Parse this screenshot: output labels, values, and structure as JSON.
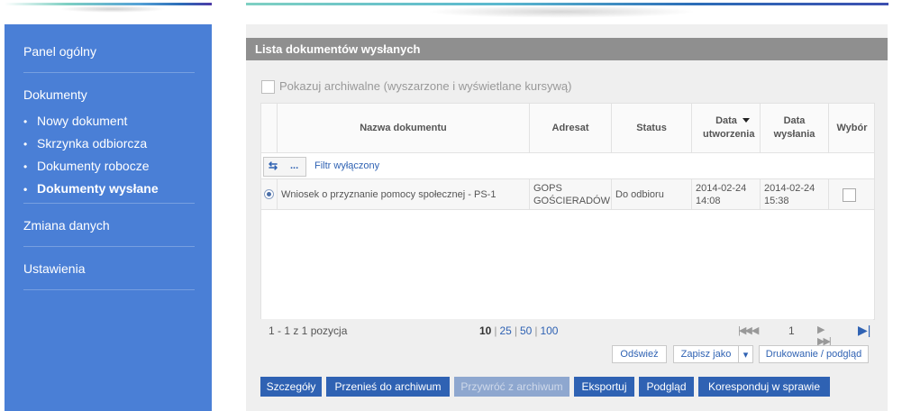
{
  "sidebar": {
    "items": [
      {
        "label": "Panel ogólny"
      },
      {
        "label": "Dokumenty"
      },
      {
        "label": "Zmiana danych"
      },
      {
        "label": "Ustawienia"
      }
    ],
    "sub_items": [
      {
        "label": "Nowy dokument",
        "active": false
      },
      {
        "label": "Skrzynka odbiorcza",
        "active": false
      },
      {
        "label": "Dokumenty robocze",
        "active": false
      },
      {
        "label": "Dokumenty wysłane",
        "active": true
      }
    ],
    "bullet": "•"
  },
  "panel": {
    "title": "Lista dokumentów wysłanych",
    "archive_label": "Pokazuj archiwalne (wyszarzone i wyświetlane kursywą)"
  },
  "grid": {
    "columns": [
      {
        "label": "Nazwa dokumentu"
      },
      {
        "label": "Adresat"
      },
      {
        "label": "Status"
      },
      {
        "label": "Data utworzenia",
        "sorted": "desc"
      },
      {
        "label": "Data wysłania"
      },
      {
        "label": "Wybór"
      }
    ],
    "filter": {
      "icon": "⇆",
      "dots": "...",
      "label": "Filtr wyłączony"
    },
    "rows": [
      {
        "name": "Wniosek o przyznanie pomocy społecznej - PS-1",
        "recipient_line1": "GOPS",
        "recipient_line2": "GOŚCIERADÓW",
        "status": "Do odbioru",
        "created_date": "2014-02-24",
        "created_time": "14:08",
        "sent_date": "2014-02-24",
        "sent_time": "15:38"
      }
    ]
  },
  "footer": {
    "count": "1 - 1 z 1 pozycja",
    "page_sizes": [
      "10",
      "25",
      "50",
      "100"
    ],
    "selected_page_size": "10",
    "current_page": "1",
    "first_prev": "|◀◀ ◀",
    "next_last": "▶ ▶▶|",
    "last_icon": "▶|"
  },
  "actions": {
    "refresh": "Odśwież",
    "save_as": "Zapisz jako",
    "save_as_dropdown": "▾",
    "print_preview": "Drukowanie / podgląd"
  },
  "bottom_buttons": [
    {
      "label": "Szczegóły",
      "enabled": true
    },
    {
      "label": "Przenieś do archiwum",
      "enabled": true
    },
    {
      "label": "Przywróć z archiwum",
      "enabled": false
    },
    {
      "label": "Eksportuj",
      "enabled": true
    },
    {
      "label": "Podgląd",
      "enabled": true
    },
    {
      "label": "Koresponduj w sprawie",
      "enabled": true
    }
  ],
  "colors": {
    "sidebar": "#4a7fd6",
    "accent_blue": "#2f62b3",
    "panel_header": "#8f8f8f"
  }
}
